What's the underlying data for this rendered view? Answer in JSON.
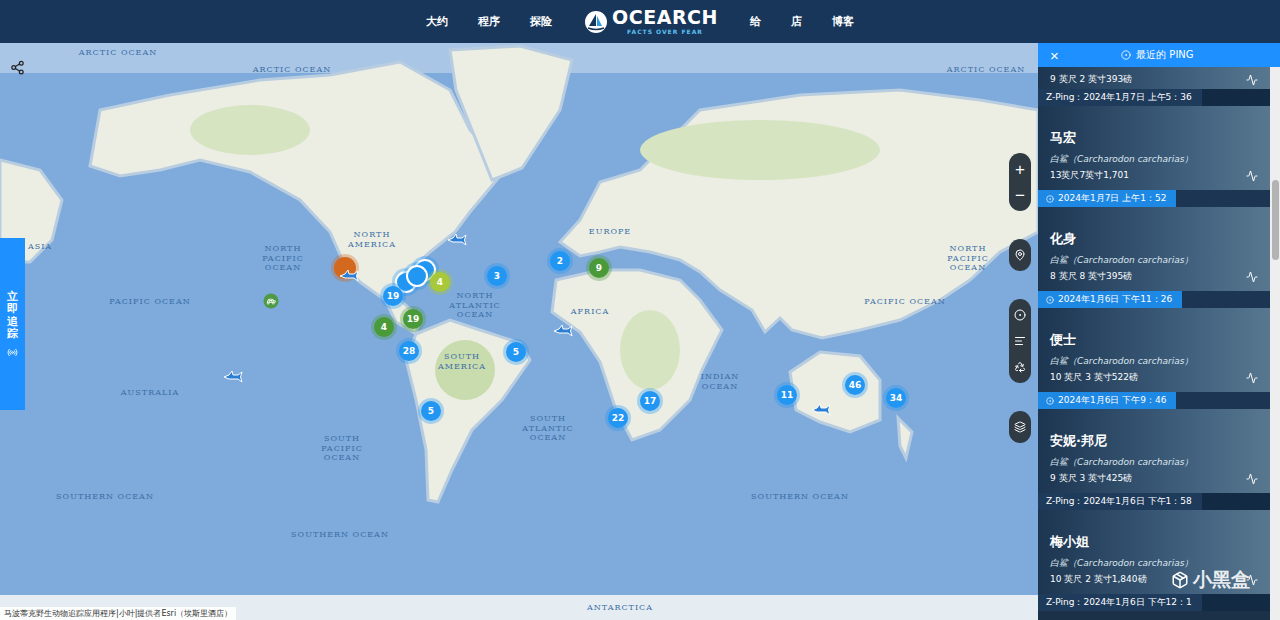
{
  "nav": {
    "left": [
      "大约",
      "程序",
      "探险"
    ],
    "logo": {
      "name": "OCEARCH",
      "tagline": "FACTS OVER FEAR"
    },
    "right": [
      "给",
      "店",
      "博客"
    ]
  },
  "track_tab": {
    "label": "立即追踪"
  },
  "map": {
    "labels": [
      {
        "text": "ARCTIC OCEAN"
      },
      {
        "text": "ARCTIC OCEAN"
      },
      {
        "text": "ARCTIC OCEAN"
      },
      {
        "text": "NORTH PACIFIC OCEAN"
      },
      {
        "text": "NORTH PACIFIC OCEAN"
      },
      {
        "text": "PACIFIC OCEAN"
      },
      {
        "text": "PACIFIC OCEAN"
      },
      {
        "text": "NORTH AMERICA"
      },
      {
        "text": "NORTH ATLANTIC OCEAN"
      },
      {
        "text": "EUROPE"
      },
      {
        "text": "AFRICA"
      },
      {
        "text": "ASIA"
      },
      {
        "text": "SOUTH AMERICA"
      },
      {
        "text": "SOUTH ATLANTIC OCEAN"
      },
      {
        "text": "INDIAN OCEAN"
      },
      {
        "text": "AUSTRALIA"
      },
      {
        "text": "SOUTH PACIFIC OCEAN"
      },
      {
        "text": "SOUTHERN OCEAN"
      },
      {
        "text": "SOUTHERN OCEAN"
      },
      {
        "text": "SOUTHERN OCEAN"
      },
      {
        "text": "ANTARCTICA"
      }
    ],
    "markers": [
      {
        "kind": "dot",
        "color": "#d2691e"
      },
      {
        "kind": "ring",
        "color": "#2196f3"
      },
      {
        "kind": "ring",
        "color": "#2196f3"
      },
      {
        "kind": "ring",
        "color": "#2196f3"
      },
      {
        "kind": "cluster",
        "count": "19",
        "color": "#2196f3"
      },
      {
        "kind": "cluster",
        "count": "4",
        "color": "#a8c83a"
      },
      {
        "kind": "cluster",
        "count": "3",
        "color": "#2196f3"
      },
      {
        "kind": "cluster",
        "count": "2",
        "color": "#2196f3"
      },
      {
        "kind": "cluster",
        "count": "9",
        "color": "#4a9a3a"
      },
      {
        "kind": "cluster",
        "count": "4",
        "color": "#4a9a3a"
      },
      {
        "kind": "cluster",
        "count": "19",
        "color": "#4a9a3a"
      },
      {
        "kind": "cluster",
        "count": "28",
        "color": "#2196f3"
      },
      {
        "kind": "cluster",
        "count": "5",
        "color": "#2196f3"
      },
      {
        "kind": "cluster",
        "count": "5",
        "color": "#2196f3"
      },
      {
        "kind": "cluster",
        "count": "22",
        "color": "#2196f3"
      },
      {
        "kind": "cluster",
        "count": "17",
        "color": "#2196f3"
      },
      {
        "kind": "cluster",
        "count": "11",
        "color": "#2196f3"
      },
      {
        "kind": "cluster",
        "count": "46",
        "color": "#2196f3"
      },
      {
        "kind": "cluster",
        "count": "34",
        "color": "#2196f3"
      }
    ],
    "animals": [
      {
        "kind": "shark"
      },
      {
        "kind": "shark"
      },
      {
        "kind": "turtle"
      },
      {
        "kind": "shark"
      },
      {
        "kind": "shark"
      },
      {
        "kind": "shark"
      }
    ],
    "zoom": [
      "+",
      "−"
    ],
    "attribution": "马波蒂克野生动物追踪应用程序|小叶|提供者Esri（埃斯里酒店）"
  },
  "panel": {
    "close": "×",
    "title": "最近的 PING",
    "pings": [
      {
        "kind": "partial",
        "size": "9 英尺 2 英寸393磅"
      },
      {
        "kind": "z",
        "ping": "Z-Ping：2024年1月7日 上午5：36",
        "name": "马宏",
        "species": "白鲨（Carcharodon carcharias）",
        "size": "13英尺7英寸1,701"
      },
      {
        "kind": "ping",
        "ping": "2024年1月7日 上午1：52",
        "name": "化身",
        "species": "白鲨（Carcharodon carcharias）",
        "size": "8 英尺 8 英寸395磅"
      },
      {
        "kind": "ping",
        "ping": "2024年1月6日 下午11：26",
        "name": "便士",
        "species": "白鲨（Carcharodon carcharias）",
        "size": "10 英尺 3 英寸522磅"
      },
      {
        "kind": "ping",
        "ping": "2024年1月6日 下午9：46",
        "name": "安妮·邦尼",
        "species": "白鲨（Carcharodon carcharias）",
        "size": "9 英尺 3 英寸425磅"
      },
      {
        "kind": "z",
        "ping": "Z-Ping：2024年1月6日 下午1：58",
        "name": "梅小姐",
        "species": "白鲨（Carcharodon carcharias）",
        "size": "10 英尺 2 英寸1,840磅"
      },
      {
        "kind": "z",
        "ping": "Z-Ping：2024年1月6日 下午12：1"
      }
    ]
  },
  "watermark": "小黑盒"
}
